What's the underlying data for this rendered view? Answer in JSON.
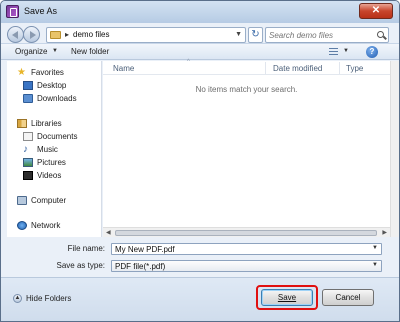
{
  "window": {
    "title": "Save As",
    "close_label": "✕"
  },
  "address": {
    "path": "demo files"
  },
  "search": {
    "placeholder": "Search demo files"
  },
  "toolbar": {
    "organize_label": "Organize",
    "new_folder_label": "New folder"
  },
  "nav": {
    "items": [
      {
        "label": "Favorites",
        "icon": "star-icon"
      },
      {
        "label": "Desktop",
        "icon": "desktop-icon"
      },
      {
        "label": "Downloads",
        "icon": "downloads-icon"
      },
      {
        "label": "Libraries",
        "icon": "libraries-icon"
      },
      {
        "label": "Documents",
        "icon": "documents-icon"
      },
      {
        "label": "Music",
        "icon": "music-icon"
      },
      {
        "label": "Pictures",
        "icon": "pictures-icon"
      },
      {
        "label": "Videos",
        "icon": "videos-icon"
      },
      {
        "label": "Computer",
        "icon": "computer-icon"
      },
      {
        "label": "Network",
        "icon": "network-icon"
      }
    ]
  },
  "files": {
    "columns": [
      "Name",
      "Date modified",
      "Type"
    ],
    "empty_message": "No items match your search."
  },
  "form": {
    "file_name_label": "File name:",
    "file_name_value": "My New PDF.pdf",
    "save_type_label": "Save as type:",
    "save_type_value": "PDF file(*.pdf)"
  },
  "footer": {
    "hide_folders_label": "Hide Folders",
    "save_label": "Save",
    "cancel_label": "Cancel"
  },
  "colors": {
    "highlight": "#e01010",
    "accent": "#3c7fb1"
  }
}
